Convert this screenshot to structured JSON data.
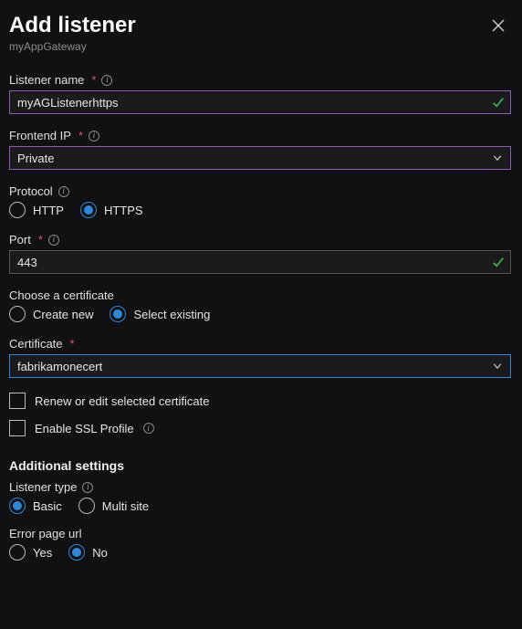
{
  "header": {
    "title": "Add listener",
    "subtitle": "myAppGateway"
  },
  "listenerName": {
    "label": "Listener name",
    "required": "*",
    "value": "myAGListenerhttps"
  },
  "frontendIp": {
    "label": "Frontend IP",
    "required": "*",
    "value": "Private"
  },
  "protocol": {
    "label": "Protocol",
    "options": {
      "http": "HTTP",
      "https": "HTTPS"
    }
  },
  "port": {
    "label": "Port",
    "required": "*",
    "value": "443"
  },
  "chooseCert": {
    "label": "Choose a certificate",
    "options": {
      "create": "Create new",
      "select": "Select existing"
    }
  },
  "certificate": {
    "label": "Certificate",
    "required": "*",
    "value": "fabrikamonecert"
  },
  "renewCert": {
    "label": "Renew or edit selected certificate"
  },
  "sslProfile": {
    "label": "Enable SSL Profile"
  },
  "additional": {
    "heading": "Additional settings"
  },
  "listenerType": {
    "label": "Listener type",
    "options": {
      "basic": "Basic",
      "multi": "Multi site"
    }
  },
  "errorPage": {
    "label": "Error page url",
    "options": {
      "yes": "Yes",
      "no": "No"
    }
  }
}
